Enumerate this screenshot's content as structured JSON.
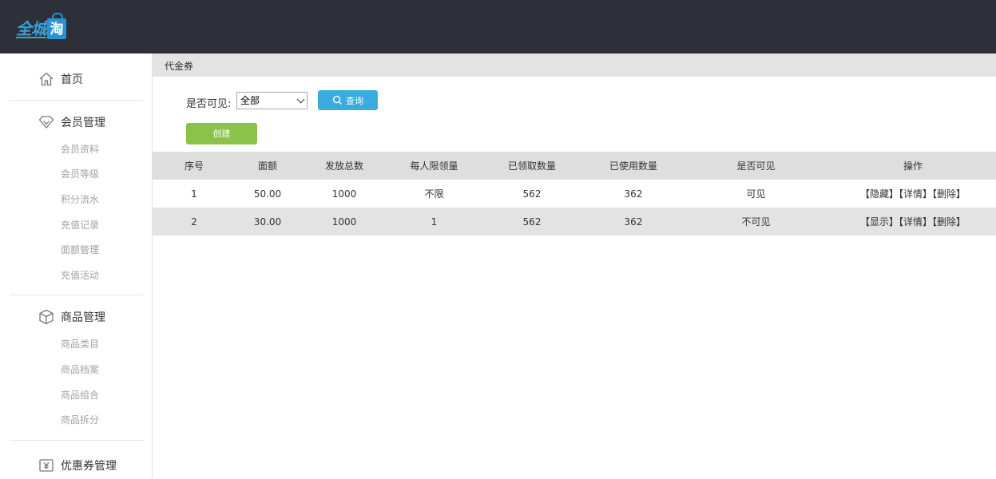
{
  "logo": {
    "text": "全城",
    "bag_char": "淘",
    "accent": "#2794d2"
  },
  "sidebar": {
    "home": "首页",
    "member": {
      "label": "会员管理",
      "items": [
        "会员资料",
        "会员等级",
        "积分流水",
        "充值记录",
        "面额管理",
        "充值活动"
      ]
    },
    "goods": {
      "label": "商品管理",
      "items": [
        "商品类目",
        "商品档案",
        "商品组合",
        "商品拆分"
      ]
    },
    "coupon": {
      "label": "优惠券管理"
    }
  },
  "breadcrumb": "代金券",
  "filter": {
    "label": "是否可见:",
    "selected": "全部",
    "query_label": "查询"
  },
  "create_label": "创建",
  "table": {
    "headers": [
      "序号",
      "面额",
      "发放总数",
      "每人限领量",
      "已领取数量",
      "已使用数量",
      "是否可见",
      "操作"
    ],
    "rows": [
      {
        "no": "1",
        "amount": "50.00",
        "total": "1000",
        "limit": "不限",
        "received": "562",
        "used": "362",
        "visible": "可见",
        "ops": [
          "【隐藏】",
          "【详情】",
          "【删除】"
        ]
      },
      {
        "no": "2",
        "amount": "30.00",
        "total": "1000",
        "limit": "1",
        "received": "562",
        "used": "362",
        "visible": "不可见",
        "ops": [
          "【显示】",
          "【详情】",
          "【删除】"
        ]
      }
    ]
  },
  "colors": {
    "topbar": "#2d3038",
    "query_button": "#3aabdf",
    "create_button": "#8bc24c"
  }
}
